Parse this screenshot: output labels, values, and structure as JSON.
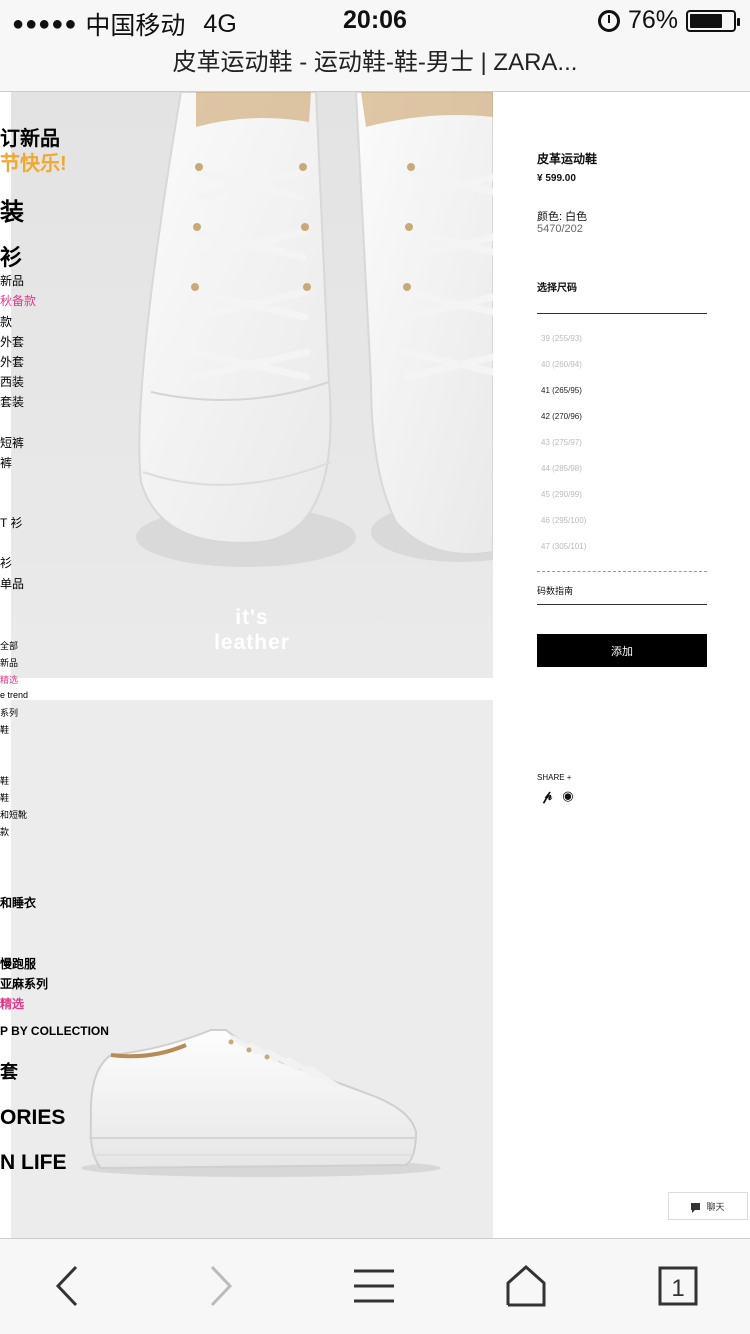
{
  "status_bar": {
    "signal": "●●●●●",
    "carrier": "中国移动",
    "network": "4G",
    "time": "20:06",
    "battery_percent": "76%",
    "battery_level": 0.76
  },
  "browser": {
    "page_title": "皮革运动鞋 - 运动鞋-鞋-男士 | ZARA..."
  },
  "left_menu": [
    "订新品",
    "节快乐!",
    "装",
    "衫",
    "新品",
    "秋备款",
    "款",
    "外套",
    "外套",
    "西装",
    "套装",
    "短裤",
    "裤",
    "T 衫",
    "衫",
    "单品",
    "全部",
    "新品",
    "精选",
    "e trend",
    "系列",
    "鞋",
    "鞋",
    "鞋",
    "和短靴",
    "款",
    "和睡衣",
    "慢跑服",
    "亚麻系列",
    "精选",
    "P BY COLLECTION",
    "套",
    "ORIES",
    "N LIFE"
  ],
  "product_images": {
    "img1_caption_line1": "it's",
    "img1_caption_line2": "leather"
  },
  "product": {
    "name": "皮革运动鞋",
    "price": "¥ 599.00",
    "color": "颜色: 白色",
    "ref": "5470/202",
    "size_title": "选择尺码",
    "sizes": [
      {
        "label": "39 (255/93)",
        "available": false
      },
      {
        "label": "40 (260/94)",
        "available": false
      },
      {
        "label": "41 (265/95)",
        "available": true
      },
      {
        "label": "42 (270/96)",
        "available": true
      },
      {
        "label": "43 (275/97)",
        "available": false
      },
      {
        "label": "44 (285/98)",
        "available": false
      },
      {
        "label": "45 (290/99)",
        "available": false
      },
      {
        "label": "46 (295/100)",
        "available": false
      },
      {
        "label": "47 (305/101)",
        "available": false
      }
    ],
    "size_guide": "码数指南",
    "add_label": "添加",
    "share_label": "SHARE +",
    "share_icons": [
      "pinterest-icon",
      "weibo-icon"
    ]
  },
  "chat": {
    "label": "聊天"
  },
  "toolbar": {
    "tabs_count": "1"
  },
  "colors": {
    "accent_pink": "#e0398a",
    "accent_orange": "#f0a830",
    "button_black": "#000000"
  }
}
